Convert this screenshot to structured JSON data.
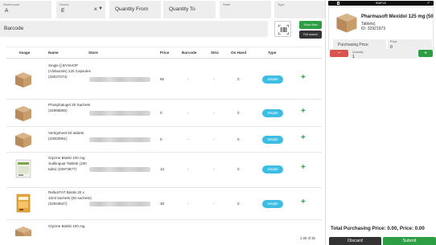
{
  "filters": {
    "warehouse_label": "Warehouse",
    "warehouse_value": "A",
    "stores_label": "Stores",
    "stores_value": "E",
    "quantity_from_placeholder": "Quantity From",
    "quantity_to_placeholder": "Quantity To",
    "state_label": "State",
    "type_label": "Type"
  },
  "barcode": {
    "placeholder": "Barcode"
  },
  "buttons": {
    "scan_view": "Scan View",
    "full_search": "Full search"
  },
  "table": {
    "columns": [
      "Image",
      "Name",
      "Store",
      "Price",
      "Barcode",
      "SKU",
      "On Hand",
      "Type"
    ],
    "rows": [
      {
        "image_icon": "box-icon",
        "name": "Single [] BYSHOP (Afobazole) 120 Capsules (33027274)",
        "price": "55",
        "barcode": "-",
        "sku": "-",
        "on_hand": "0",
        "type": "simple"
      },
      {
        "image_icon": "box-icon",
        "name": "Phosphalugel 20 Sachets (32966855)",
        "price": "0",
        "barcode": "-",
        "sku": "-",
        "on_hand": "0",
        "type": "simple"
      },
      {
        "image_icon": "box-icon",
        "name": "Vertigoheel 50 tablets (33003951)",
        "price": "0",
        "barcode": "-",
        "sku": "-",
        "on_hand": "0",
        "type": "simple"
      },
      {
        "image_icon": "product-package-icon",
        "name": "Glycine Biotiki 100 mg Sublingual Tablets (100 tabs) (32973677)",
        "price": "12",
        "barcode": "-",
        "sku": "-",
        "on_hand": "0",
        "type": "simple"
      },
      {
        "image_icon": "product-package-icon",
        "name": "RelluSTAT Biotiki 20 x 10ml sachets (20 sachets) (32943647)",
        "price": "30",
        "barcode": "-",
        "sku": "-",
        "on_hand": "0",
        "type": "simple"
      },
      {
        "image_icon": "box-icon",
        "name": "Glycine Biotiki 100 mg",
        "price": "",
        "barcode": "",
        "sku": "",
        "on_hand": "",
        "type": ""
      }
    ]
  },
  "pagination": {
    "text": "1-25 of 25"
  },
  "cart": {
    "header_title": "SIMPLE",
    "item": {
      "name": "Pharmasoft Mexidol 125 mg (50",
      "sub": "Tablets)",
      "id": "ID: 32921973",
      "purchasing_price_placeholder": "Purchasing Price",
      "price_label": "Price",
      "price_value": "0",
      "quantity_label": "Quantity",
      "quantity_value": "1"
    },
    "totals_text": "Total Purchasing Price: 0.00, Price: 0.00",
    "discard_label": "Discard",
    "submit_label": "Submit"
  },
  "colors": {
    "accent_green": "#2e9e44",
    "pill_blue": "#3bbde4",
    "danger_red": "#d9534f",
    "dark": "#333333"
  }
}
